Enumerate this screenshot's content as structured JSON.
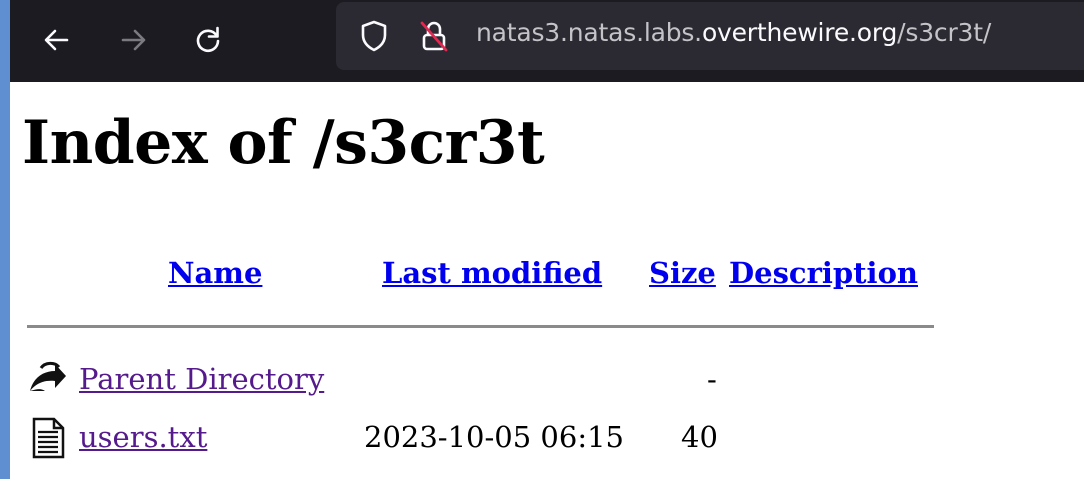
{
  "browser": {
    "url_prefix": "natas3.natas.labs.",
    "url_domain": "overthewire.org",
    "url_suffix": "/s3cr3t/",
    "icons": [
      "back-arrow-icon",
      "forward-arrow-icon",
      "reload-icon",
      "shield-icon",
      "insecure-lock-icon"
    ]
  },
  "page": {
    "title": "Index of /s3cr3t",
    "columns": {
      "name": "Name",
      "last_modified": "Last modified",
      "size": "Size",
      "description": "Description"
    },
    "rows": [
      {
        "icon": "parent-directory-icon",
        "name": "Parent Directory",
        "last_modified": "",
        "size": "-",
        "description": ""
      },
      {
        "icon": "text-file-icon",
        "name": "users.txt",
        "last_modified": "2023-10-05 06:15",
        "size": "40",
        "description": ""
      }
    ]
  }
}
